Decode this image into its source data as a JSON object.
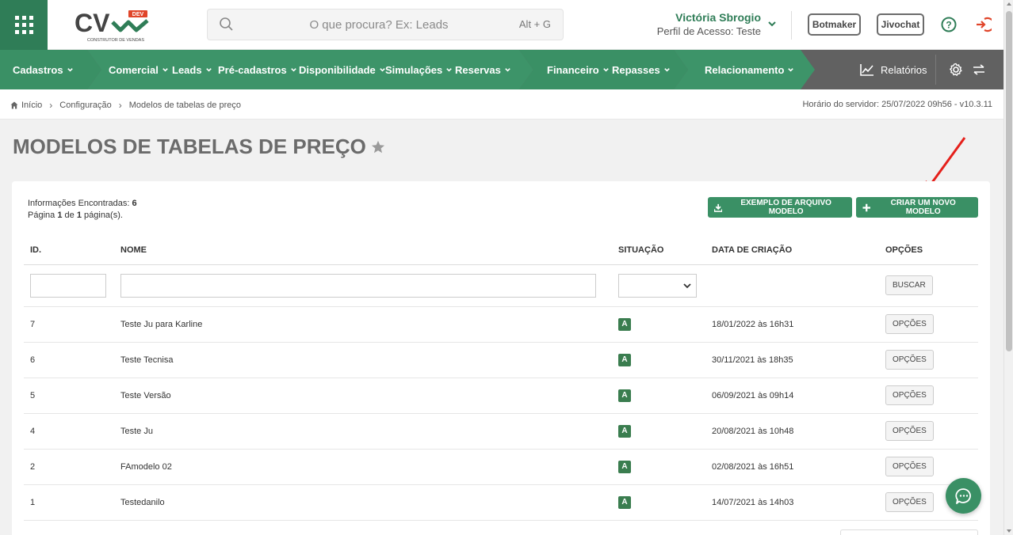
{
  "header": {
    "logo_text": "CV",
    "logo_badge": "DEV",
    "logo_tagline": "CONSTRUTOR DE VENDAS",
    "search_placeholder": "O que procura? Ex: Leads",
    "search_shortcut": "Alt + G",
    "user_name": "Victória Sbrogio",
    "user_profile": "Perfil de Acesso: Teste",
    "botmaker_label": "Botmaker",
    "jivochat_label": "Jivochat",
    "icons": [
      "apps-grid-icon",
      "search-icon",
      "chevron-down-icon",
      "help-icon",
      "logout-icon"
    ]
  },
  "nav": {
    "items": [
      {
        "label": "Cadastros"
      },
      {
        "label": "Comercial"
      },
      {
        "label": "Leads"
      },
      {
        "label": "Pré-cadastros"
      },
      {
        "label": "Disponibilidade"
      },
      {
        "label": "Simulações"
      },
      {
        "label": "Reservas"
      },
      {
        "label": "Financeiro"
      },
      {
        "label": "Repasses"
      },
      {
        "label": "Relacionamento"
      }
    ],
    "reports_label": "Relatórios",
    "icons": [
      "chart-line-icon",
      "gear-icon",
      "swap-arrows-icon"
    ]
  },
  "breadcrumb": {
    "items": [
      "Início",
      "Configuração",
      "Modelos de tabelas de preço"
    ],
    "server_time": "Horário do servidor: 25/07/2022 09h56 - v10.3.11"
  },
  "page": {
    "title": "MODELOS DE TABELAS DE PREÇO"
  },
  "card": {
    "info_found_label": "Informações Encontradas:",
    "info_found_count": "6",
    "page_word": "Página",
    "page_current": "1",
    "page_of": "de",
    "page_total": "1",
    "page_suffix": "página(s).",
    "example_button_label": "EXEMPLO DE ARQUIVO MODELO",
    "create_button_label": "CRIAR UM NOVO MODELO"
  },
  "table": {
    "columns": [
      "ID.",
      "NOME",
      "SITUAÇÃO",
      "DATA DE CRIAÇÃO",
      "OPÇÕES"
    ],
    "search_button_label": "BUSCAR",
    "options_button_label": "OPÇÕES",
    "rows": [
      {
        "id": "7",
        "name": "Teste Ju para Karline",
        "status": "A",
        "date": "18/01/2022 às 16h31"
      },
      {
        "id": "6",
        "name": "Teste Tecnisa",
        "status": "A",
        "date": "30/11/2021 às 18h35"
      },
      {
        "id": "5",
        "name": "Teste Versão",
        "status": "A",
        "date": "06/09/2021 às 09h14"
      },
      {
        "id": "4",
        "name": "Teste Ju",
        "status": "A",
        "date": "20/08/2021 às 10h48"
      },
      {
        "id": "2",
        "name": "FAmodelo 02",
        "status": "A",
        "date": "02/08/2021 às 16h51"
      },
      {
        "id": "1",
        "name": "Testedanilo",
        "status": "A",
        "date": "14/07/2021 às 14h03"
      }
    ]
  },
  "colors": {
    "brand_green": "#2f7d57",
    "nav_green": "#3a9065",
    "nav_gray": "#616161",
    "logout_red": "#e0452a",
    "badge_green": "#3a7d4f",
    "arrow_red": "#e5201b"
  }
}
